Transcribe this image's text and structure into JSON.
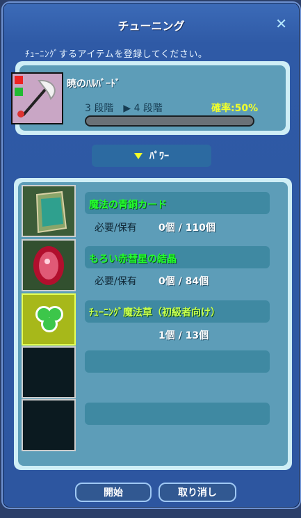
{
  "window": {
    "title": "チューニング",
    "close_glyph": "✕"
  },
  "instruction": "ﾁｭｰﾆﾝｸﾞするアイテムを登録してください。",
  "target": {
    "name": "暁のﾊﾙﾊﾞｰﾄﾞ",
    "stage_text": "3 段階　▶ 4 段階",
    "rate": "確率:50%",
    "progress_fraction": 0
  },
  "power_button": {
    "label": "ﾊﾟﾜｰ"
  },
  "materials": {
    "required_label": "必要/保有",
    "items": [
      {
        "name": "魔法の青銅カード",
        "count": "0個 /  110個"
      },
      {
        "name": "もろい赤彗星の結晶",
        "count": "0個 /   84個"
      },
      {
        "name": "ﾁｭｰﾆﾝｸﾞ魔法草（初級者向け）",
        "count": "1個 /  13個"
      }
    ]
  },
  "buttons": {
    "start": "開始",
    "cancel": "取り消し"
  },
  "colors": {
    "accent": "#f1ff2a",
    "material_name": "#23ff2b"
  }
}
